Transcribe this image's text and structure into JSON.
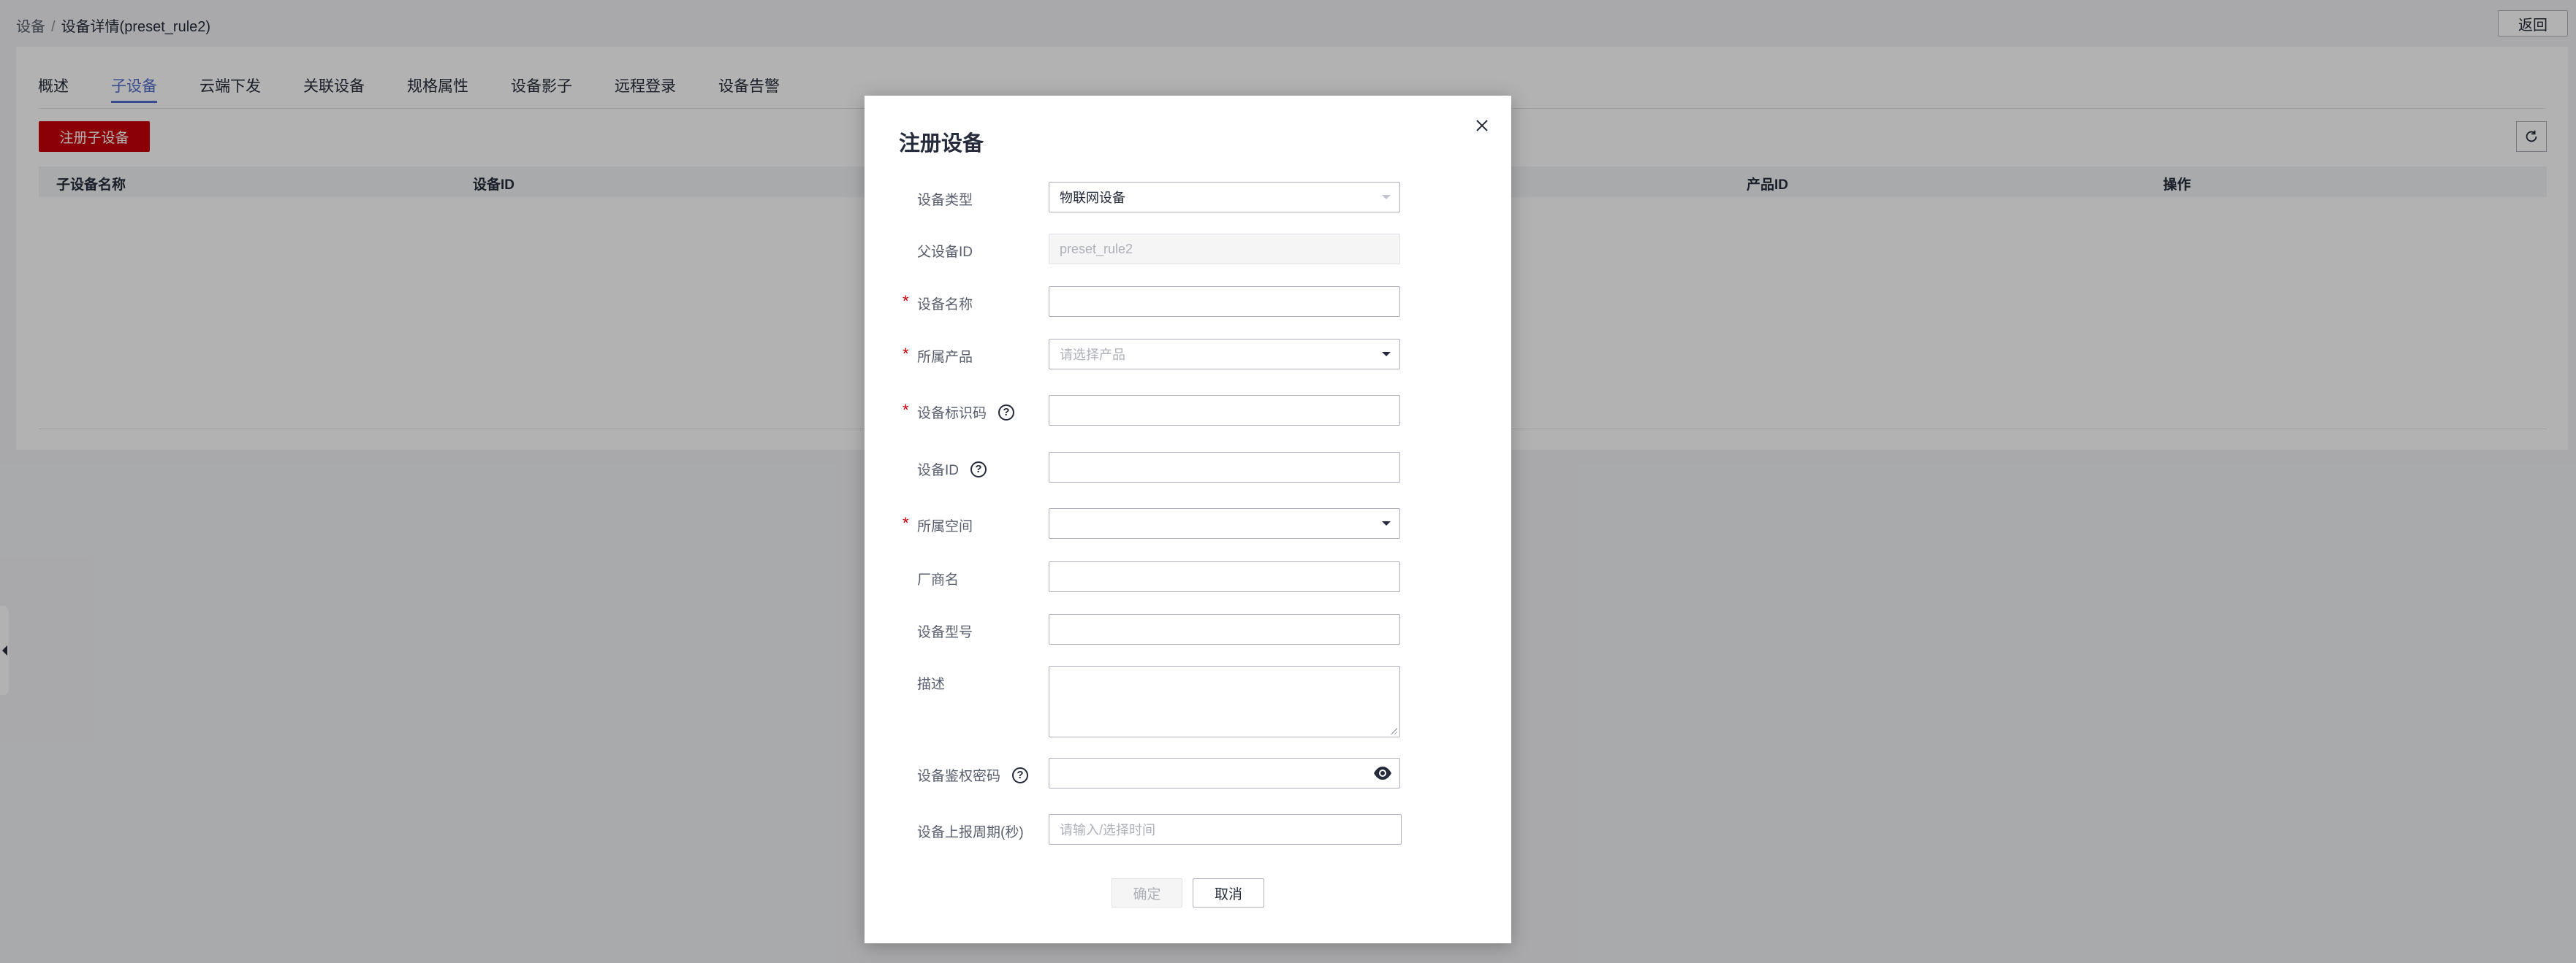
{
  "breadcrumb": {
    "root": "设备",
    "separator": "/",
    "current": "设备详情(preset_rule2)"
  },
  "header": {
    "back_label": "返回"
  },
  "tabs": [
    {
      "label": "概述"
    },
    {
      "label": "子设备"
    },
    {
      "label": "云端下发"
    },
    {
      "label": "关联设备"
    },
    {
      "label": "规格属性"
    },
    {
      "label": "设备影子"
    },
    {
      "label": "远程登录"
    },
    {
      "label": "设备告警"
    }
  ],
  "active_tab": "子设备",
  "toolbar": {
    "register_sub_label": "注册子设备",
    "refresh_icon": "refresh-icon"
  },
  "table": {
    "columns": [
      "子设备名称",
      "设备ID",
      "产品ID",
      "操作"
    ]
  },
  "modal": {
    "title": "注册设备",
    "close_icon": "close-icon",
    "fields": {
      "device_type": {
        "label": "设备类型",
        "value": "物联网设备"
      },
      "parent_id": {
        "label": "父设备ID",
        "value": "preset_rule2"
      },
      "device_name": {
        "label": "设备名称",
        "value": ""
      },
      "product": {
        "label": "所属产品",
        "placeholder": "请选择产品"
      },
      "node_id": {
        "label": "设备标识码",
        "value": ""
      },
      "device_id": {
        "label": "设备ID",
        "value": ""
      },
      "space": {
        "label": "所属空间",
        "value": ""
      },
      "manufacturer": {
        "label": "厂商名",
        "value": ""
      },
      "model": {
        "label": "设备型号",
        "value": ""
      },
      "description": {
        "label": "描述",
        "value": ""
      },
      "secret": {
        "label": "设备鉴权密码",
        "value": ""
      },
      "report_period": {
        "label": "设备上报周期(秒)",
        "placeholder": "请输入/选择时间"
      }
    },
    "confirm_label": "确定",
    "cancel_label": "取消"
  },
  "colors": {
    "accent": "#526ecc",
    "primary_button": "#c7000b",
    "required": "#c7000b"
  }
}
